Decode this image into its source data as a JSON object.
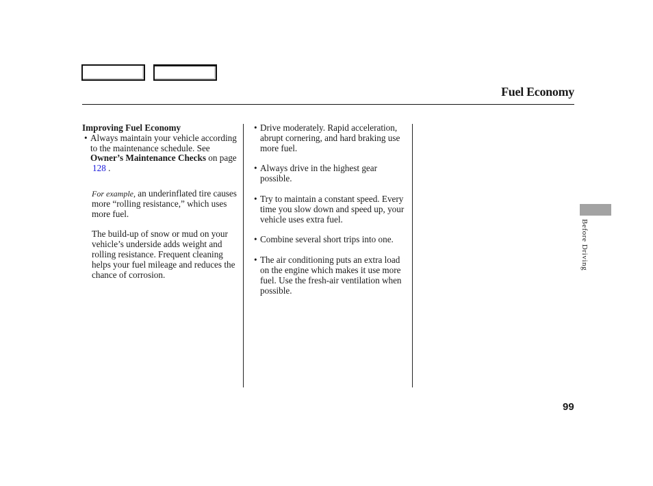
{
  "nav": {
    "prev_label": "",
    "next_label": ""
  },
  "header": {
    "title": "Fuel Economy"
  },
  "column1": {
    "heading": "Improving Fuel Economy",
    "bullet1": {
      "text_a": "Always maintain your vehicle according to the maintenance schedule. See ",
      "bold": "Owner’s Maintenance Checks",
      "text_b": " on page",
      "link": "128",
      "end": " ."
    },
    "para1": {
      "italic": "For example,",
      "text": " an underinflated tire causes more “rolling resistance,” which uses more fuel."
    },
    "para2": "The build-up of snow or mud on your vehicle’s underside adds weight and rolling resistance. Frequent cleaning helps your fuel mileage and reduces the chance of corrosion."
  },
  "column2": {
    "bullets": [
      "Drive moderately. Rapid acceleration, abrupt cornering, and hard braking use more fuel.",
      "Always drive in the highest gear possible.",
      "Try to maintain a constant speed. Every time you slow down and speed up, your vehicle uses extra fuel.",
      "Combine several short trips into one.",
      "The air conditioning puts an extra load on the engine which makes it use more fuel. Use the fresh-air ventilation when possible."
    ]
  },
  "sidebar": {
    "section_label": "Before Driving",
    "tab_color": "#a3a3a3"
  },
  "footer": {
    "page_number": "99"
  },
  "bullet_glyph": "•"
}
